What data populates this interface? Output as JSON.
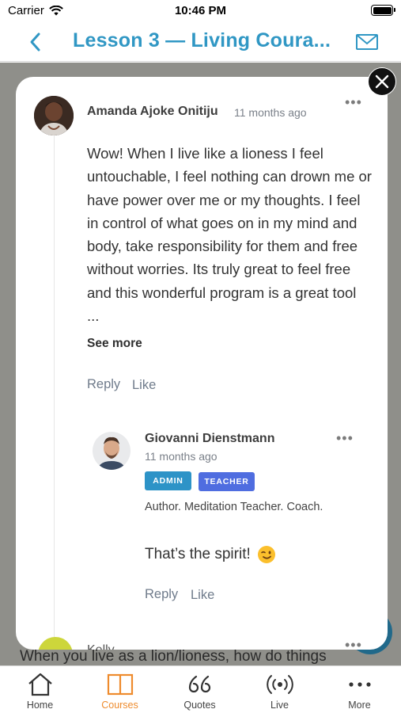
{
  "status_bar": {
    "carrier": "Carrier",
    "time": "10:46 PM"
  },
  "nav": {
    "title": "Lesson 3 — Living Coura..."
  },
  "background": {
    "peek_text": "When you live as a lion/lioness, how do things"
  },
  "comment": {
    "author": "Amanda Ajoke Onitiju",
    "time": "11 months ago",
    "body": "Wow! When I live like a lioness I feel untouchable, I feel nothing can drown me or have power over me or my thoughts. I feel in control of what goes on in my mind and body, take responsibility for them and free without worries. Its truly great to feel free and this wonderful program is a great tool ...",
    "see_more": "See more",
    "reply_label": "Reply",
    "like_label": "Like"
  },
  "reply": {
    "author": "Giovanni Dienstmann",
    "time": "11 months ago",
    "badges": [
      "ADMIN",
      "TEACHER"
    ],
    "bio": "Author. Meditation Teacher. Coach.",
    "body": "That’s the spirit!",
    "reply_label": "Reply",
    "like_label": "Like"
  },
  "next_comment": {
    "author_partial": "Kelly"
  },
  "tabs": [
    {
      "label": "Home",
      "icon": "home-icon",
      "active": false
    },
    {
      "label": "Courses",
      "icon": "book-icon",
      "active": true
    },
    {
      "label": "Quotes",
      "icon": "quote-icon",
      "active": false
    },
    {
      "label": "Live",
      "icon": "broadcast-icon",
      "active": false
    },
    {
      "label": "More",
      "icon": "more-dots-icon",
      "active": false
    }
  ],
  "colors": {
    "accent": "#3097c4",
    "active_tab": "#ee8b2d",
    "admin_badge": "#2d93c7",
    "teacher_badge": "#4f6de0",
    "backdrop": "#8f8f8a"
  }
}
